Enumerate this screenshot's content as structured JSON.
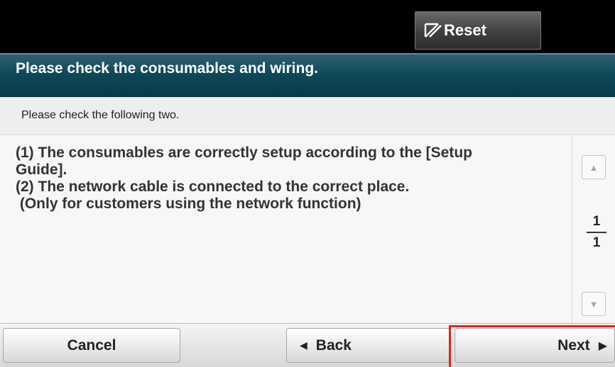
{
  "header": {
    "reset_label": "Reset"
  },
  "title": "Please check the consumables and wiring.",
  "subtitle": "Please check the following two.",
  "message": {
    "lines": [
      "(1) The consumables are correctly setup according to the [Setup",
      "Guide].",
      "(2) The network cable is connected to the correct place.",
      " (Only for customers using the network function)"
    ]
  },
  "pager": {
    "current": "1",
    "total": "1"
  },
  "buttons": {
    "cancel": "Cancel",
    "back": "Back",
    "next": "Next"
  },
  "icons": {
    "reset": "reset-icon",
    "scroll_up": "up-arrow-icon",
    "scroll_down": "down-arrow-icon",
    "back": "left-arrow-icon",
    "next": "right-arrow-icon"
  },
  "colors": {
    "title_bar": "#0e4657",
    "top_bar": "#000000",
    "highlight": "#e2231a"
  }
}
